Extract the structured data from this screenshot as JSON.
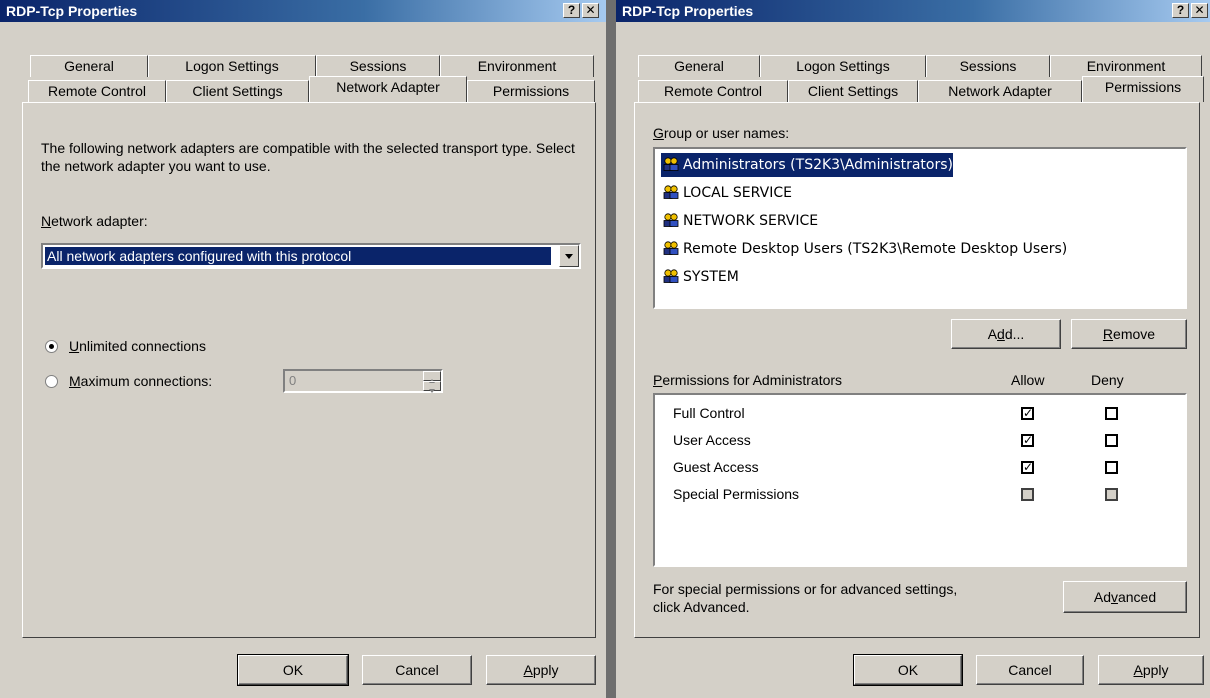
{
  "left_dialog": {
    "title": "RDP-Tcp Properties",
    "help_btn": "?",
    "close_btn": "✕",
    "tabs_row1": [
      "General",
      "Logon Settings",
      "Sessions",
      "Environment"
    ],
    "tabs_row2": [
      "Remote Control",
      "Client Settings",
      "Network Adapter",
      "Permissions"
    ],
    "active_tab": "Network Adapter",
    "description": "The following network adapters are compatible with the selected transport type. Select the network adapter you want to use.",
    "adapter_label_u": "N",
    "adapter_label_rest": "etwork adapter:",
    "adapter_value": "All network adapters configured with this protocol",
    "radio_unlimited_u": "U",
    "radio_unlimited_rest": "nlimited connections",
    "radio_max_u": "M",
    "radio_max_rest": "aximum connections:",
    "max_connections_value": "0",
    "selected_radio": "unlimited",
    "ok": "OK",
    "cancel": "Cancel",
    "apply_u": "A",
    "apply_rest": "pply"
  },
  "right_dialog": {
    "title": "RDP-Tcp Properties",
    "help_btn": "?",
    "close_btn": "✕",
    "tabs_row1": [
      "General",
      "Logon Settings",
      "Sessions",
      "Environment"
    ],
    "tabs_row2": [
      "Remote Control",
      "Client Settings",
      "Network Adapter",
      "Permissions"
    ],
    "active_tab": "Permissions",
    "group_label_u": "G",
    "group_label_rest": "roup or user names:",
    "users": [
      "Administrators (TS2K3\\Administrators)",
      "LOCAL SERVICE",
      "NETWORK SERVICE",
      "Remote Desktop Users (TS2K3\\Remote Desktop Users)",
      "SYSTEM"
    ],
    "selected_user": 0,
    "add_btn_pre": "A",
    "add_btn_u": "d",
    "add_btn_post": "d...",
    "remove_btn_u": "R",
    "remove_btn_rest": "emove",
    "perm_label_u": "P",
    "perm_label_rest": "ermissions for Administrators",
    "allow_header": "Allow",
    "deny_header": "Deny",
    "permissions": [
      {
        "name": "Full Control",
        "allow": true,
        "deny": false
      },
      {
        "name": "User Access",
        "allow": true,
        "deny": false
      },
      {
        "name": "Guest Access",
        "allow": true,
        "deny": false
      },
      {
        "name": "Special Permissions",
        "allow": false,
        "deny": false,
        "disabled": true
      }
    ],
    "advanced_note_line1": "For special permissions or for advanced settings,",
    "advanced_note_line2": "click Advanced.",
    "advanced_pre": "Ad",
    "advanced_u": "v",
    "advanced_post": "anced",
    "ok": "OK",
    "cancel": "Cancel",
    "apply_u": "A",
    "apply_rest": "pply"
  },
  "colors": {
    "dialog_bg": "#d4d0c8",
    "title_start": "#0a246a",
    "selection": "#0a246a"
  }
}
